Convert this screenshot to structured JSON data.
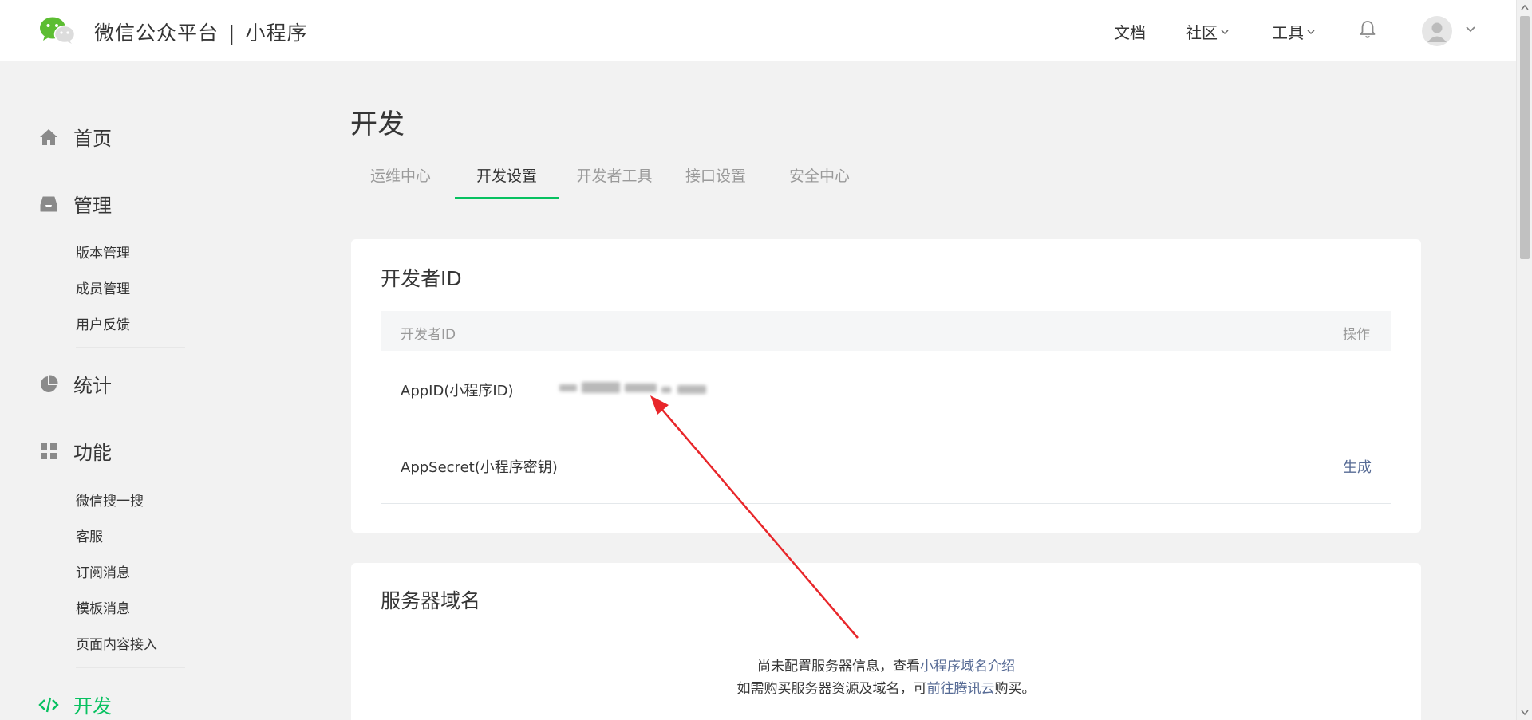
{
  "header": {
    "brand": "微信公众平台",
    "separator": "|",
    "product": "小程序",
    "nav": {
      "docs": "文档",
      "community": "社区",
      "tools": "工具"
    },
    "icons": [
      "wechat-logo-icon",
      "chevron-down-icon",
      "bell-icon",
      "avatar-icon"
    ]
  },
  "sidebar": {
    "home": "首页",
    "manage": "管理",
    "manage_items": [
      "版本管理",
      "成员管理",
      "用户反馈"
    ],
    "stats": "统计",
    "features": "功能",
    "feature_items": [
      "微信搜一搜",
      "客服",
      "订阅消息",
      "模板消息",
      "页面内容接入"
    ],
    "develop": "开发"
  },
  "main": {
    "title": "开发",
    "tabs": [
      "运维中心",
      "开发设置",
      "开发者工具",
      "接口设置",
      "安全中心"
    ],
    "active_tab": "开发设置",
    "dev_id": {
      "title": "开发者ID",
      "col_name": "开发者ID",
      "col_action": "操作",
      "appid_label": "AppID(小程序ID)",
      "appsecret_label": "AppSecret(小程序密钥)",
      "generate": "生成"
    },
    "server_domain": {
      "title": "服务器域名",
      "line1_prefix": "尚未配置服务器信息，查看",
      "line1_link": "小程序域名介绍",
      "line2_prefix": "如需购买服务器资源及域名，可",
      "line2_link": "前往腾讯云",
      "line2_suffix": "购买。"
    }
  },
  "colors": {
    "accent": "#07c160",
    "link": "#576b95",
    "annotation_arrow": "#e8262a"
  }
}
